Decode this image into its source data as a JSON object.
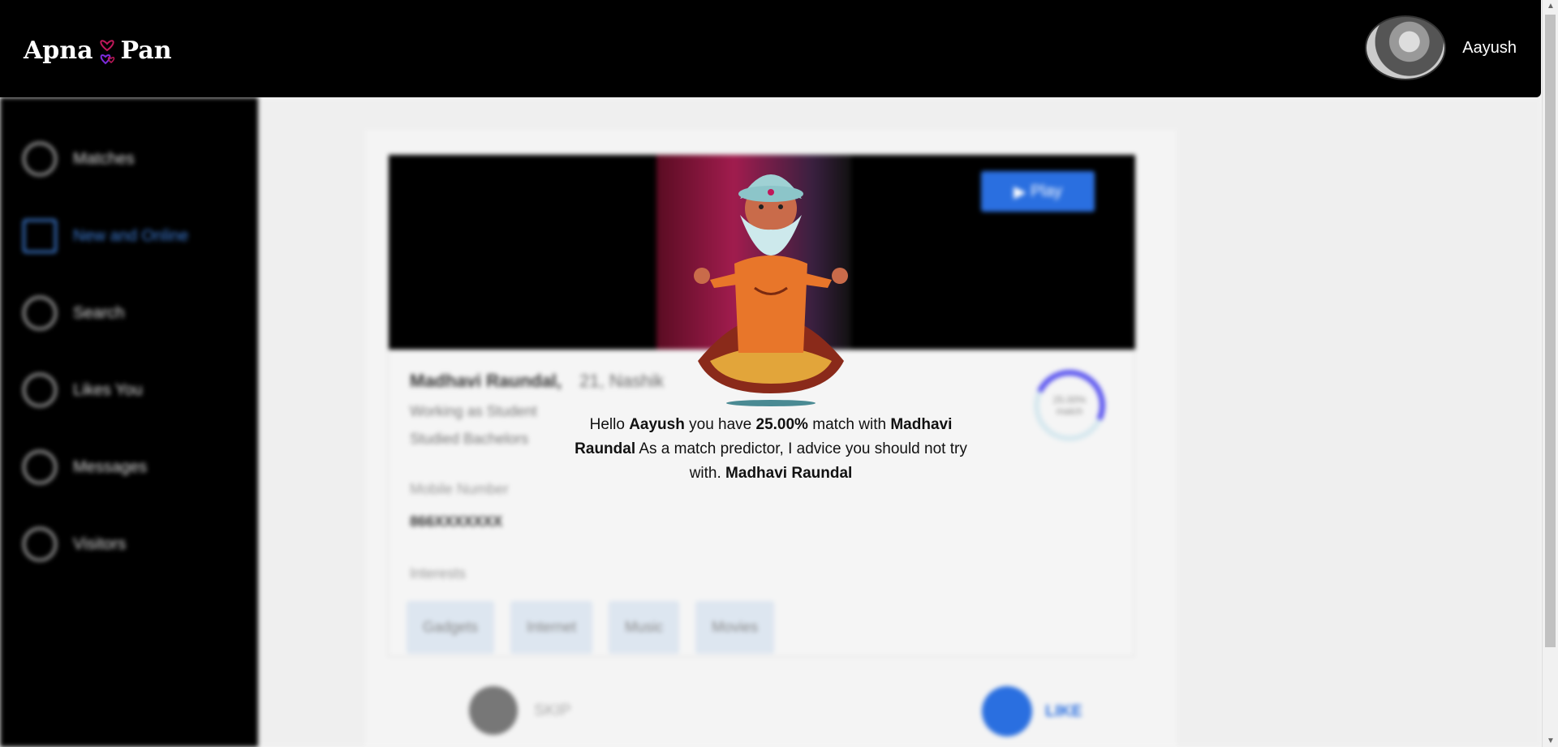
{
  "app": {
    "logo_left": "Apna",
    "logo_right": "Pan"
  },
  "header": {
    "user_name": "Aayush"
  },
  "sidebar": {
    "items": [
      {
        "label": "Matches",
        "icon": "matches-icon",
        "active": false
      },
      {
        "label": "New and Online",
        "icon": "new-online-icon",
        "active": true
      },
      {
        "label": "Search",
        "icon": "search-icon",
        "active": false
      },
      {
        "label": "Likes You",
        "icon": "heart-icon",
        "active": false
      },
      {
        "label": "Messages",
        "icon": "chat-icon",
        "active": false
      },
      {
        "label": "Visitors",
        "icon": "visitors-icon",
        "active": false
      }
    ]
  },
  "profile": {
    "name": "Madhavi Raundal,",
    "age_city": "21, Nashik",
    "work": "Working as Student",
    "education": "Studied Bachelors",
    "mobile_label": "Mobile Number",
    "mobile_value": "866XXXXXXX",
    "interests_label": "Interests",
    "interests": [
      "Gadgets",
      "Internet",
      "Music",
      "Movies"
    ],
    "play_label": "Play",
    "match_percent_text": "25.00% match",
    "match_fraction": 0.25
  },
  "actions": {
    "skip_label": "SKIP",
    "like_label": "LIKE"
  },
  "overlay": {
    "p1": "Hello ",
    "user": "Aayush",
    "p2": " you have ",
    "percent": "25.00%",
    "p3": " match with ",
    "match_name": "Madhavi Raundal",
    "p4": " As a match predictor, I advice you should not try with. ",
    "match_name_2": "Madhavi Raundal"
  },
  "colors": {
    "accent": "#2a6fe0",
    "header_bg": "#000000",
    "donut_arc": "#5b55f0"
  }
}
